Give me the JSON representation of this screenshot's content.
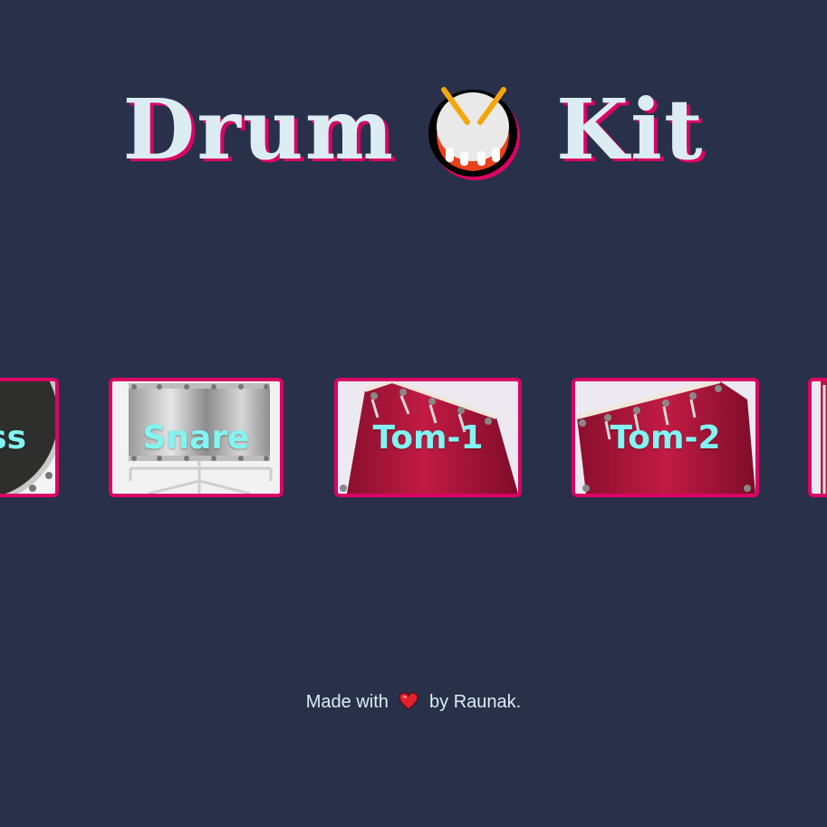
{
  "title": {
    "word1": "Drum",
    "icon": "drum-emoji-icon",
    "word2": "Kit"
  },
  "drums": [
    {
      "label": "Bass",
      "visible_label": "ss",
      "icon": "bass-drum-image"
    },
    {
      "label": "Snare",
      "icon": "snare-drum-image"
    },
    {
      "label": "Tom-1",
      "icon": "tom-drum-image"
    },
    {
      "label": "Tom-2",
      "icon": "tom-drum-image"
    },
    {
      "label": "",
      "icon": "tom-drum-image"
    }
  ],
  "footer": {
    "prefix": "Made with",
    "icon": "heart-icon",
    "suffix": "by Raunak."
  },
  "colors": {
    "background": "#283149",
    "title_text": "#dbedf3",
    "accent": "#da0463",
    "drum_label": "#81f5f1",
    "tom_red": "#b5173f"
  }
}
